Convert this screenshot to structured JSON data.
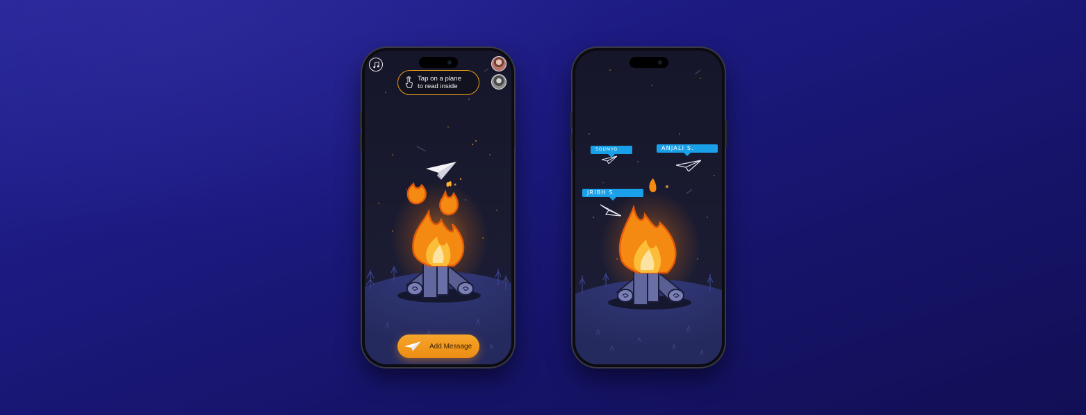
{
  "screens": [
    {
      "id": "campfire-home",
      "hint": {
        "text": "Tap on a plane\nto read inside",
        "icon": "tap-finger-icon",
        "border_color": "#e89a1c"
      },
      "music_button": {
        "icon": "music-note-icon"
      },
      "participants": [
        {
          "avatar": "avatar-female"
        },
        {
          "avatar": "avatar-male"
        }
      ],
      "add_message_button": {
        "label": "Add Message",
        "icon": "paper-plane-icon",
        "color": "#f29a1e"
      },
      "illustration": [
        "campfire",
        "paper-plane",
        "stars",
        "pine-trees",
        "night-sky"
      ]
    },
    {
      "id": "campfire-planes",
      "plane_labels": [
        "SOUMYO",
        "ANJALI S.",
        "JRIBH S."
      ],
      "label_color": "#1aa0e8",
      "illustration": [
        "campfire",
        "paper-planes",
        "stars",
        "night-sky"
      ]
    }
  ],
  "colors": {
    "background": "#1c1a80",
    "fire_orange": "#f08a12",
    "fire_yellow": "#fbbd3a",
    "ground": "#2a2e68",
    "sky": "#15162a"
  }
}
